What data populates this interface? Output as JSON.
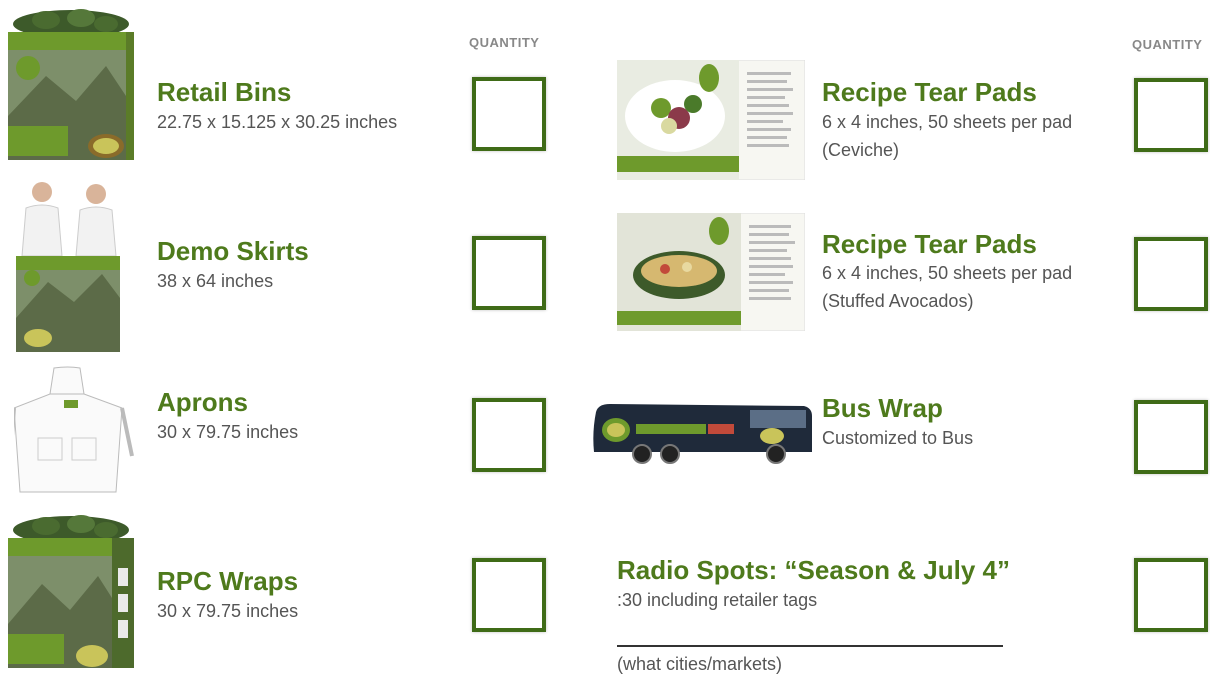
{
  "quantity_label": "QUANTITY",
  "left_items": [
    {
      "title": "Retail Bins",
      "desc_lines": [
        "22.75 x 15.125 x 30.25 inches"
      ],
      "image_icon": "retail-bin-image"
    },
    {
      "title": "Demo Skirts",
      "desc_lines": [
        "38 x 64 inches"
      ],
      "image_icon": "demo-skirt-image"
    },
    {
      "title": "Aprons",
      "desc_lines": [
        "30 x 79.75 inches"
      ],
      "image_icon": "apron-image"
    },
    {
      "title": "RPC Wraps",
      "desc_lines": [
        "30 x 79.75 inches"
      ],
      "image_icon": "rpc-wrap-image"
    }
  ],
  "right_items": [
    {
      "title": "Recipe Tear Pads",
      "desc_lines": [
        "6 x 4 inches, 50 sheets per pad",
        "(Ceviche)"
      ],
      "image_icon": "recipe-pad-ceviche-image"
    },
    {
      "title": "Recipe Tear Pads",
      "desc_lines": [
        "6 x 4 inches, 50 sheets per pad",
        "(Stuffed Avocados)"
      ],
      "image_icon": "recipe-pad-stuffed-image"
    },
    {
      "title": "Bus Wrap",
      "desc_lines": [
        "Customized to Bus"
      ],
      "image_icon": "bus-wrap-image"
    },
    {
      "title": "Radio Spots: “Season & July 4”",
      "desc_lines": [
        ":30 including retailer tags"
      ],
      "image_icon": ""
    }
  ],
  "radio_markets_label": "(what cities/markets)",
  "colors": {
    "accent": "#4e7a1c",
    "box_border": "#3f6b17",
    "text": "#555555"
  }
}
